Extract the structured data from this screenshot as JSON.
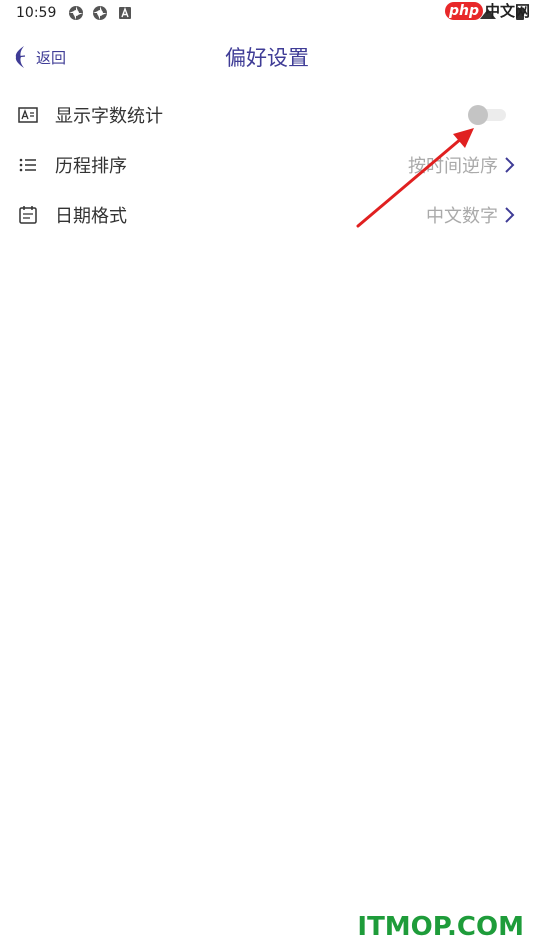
{
  "status_bar": {
    "time": "10:59"
  },
  "watermark_top": {
    "php": "php",
    "cn": "中文网"
  },
  "header": {
    "back_label": "返回",
    "title": "偏好设置"
  },
  "settings": [
    {
      "label": "显示字数统计",
      "icon": "word-count-icon",
      "control": "toggle",
      "toggle_on": false
    },
    {
      "label": "历程排序",
      "icon": "list-icon",
      "control": "value",
      "value": "按时间逆序"
    },
    {
      "label": "日期格式",
      "icon": "calendar-icon",
      "control": "value",
      "value": "中文数字"
    }
  ],
  "colors": {
    "accent": "#3f3c96",
    "annotation": "#e02020",
    "watermark_green": "#1e9c3a"
  },
  "watermark_bottom": "ITMOP.COM"
}
